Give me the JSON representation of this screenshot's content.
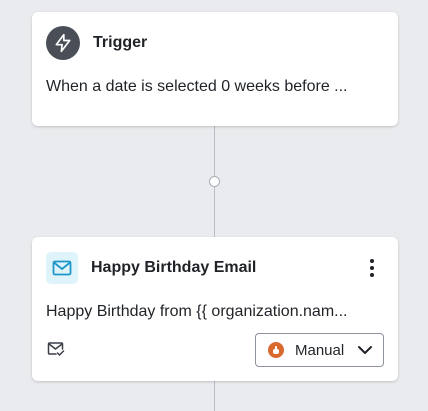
{
  "colors": {
    "canvas_bg": "#e9ebee",
    "card_bg": "#ffffff",
    "trigger_icon_bg": "#4a4f57",
    "email_icon_bg": "#dff3fb",
    "email_icon_stroke": "#1e96c8",
    "manual_badge": "#d9692c",
    "connector": "#b7bcc3"
  },
  "trigger_card": {
    "icon": "lightning-bolt-icon",
    "title": "Trigger",
    "description": "When a date is selected 0 weeks before ..."
  },
  "email_card": {
    "icon": "envelope-icon",
    "title": "Happy Birthday Email",
    "description": "Happy Birthday from {{ organization.nam...",
    "menu_icon": "kebab-menu-icon",
    "status_icon": "mail-check-icon",
    "mode_select": {
      "badge_icon": "hand-pointer-icon",
      "value": "Manual",
      "chevron": "chevron-down-icon"
    }
  }
}
